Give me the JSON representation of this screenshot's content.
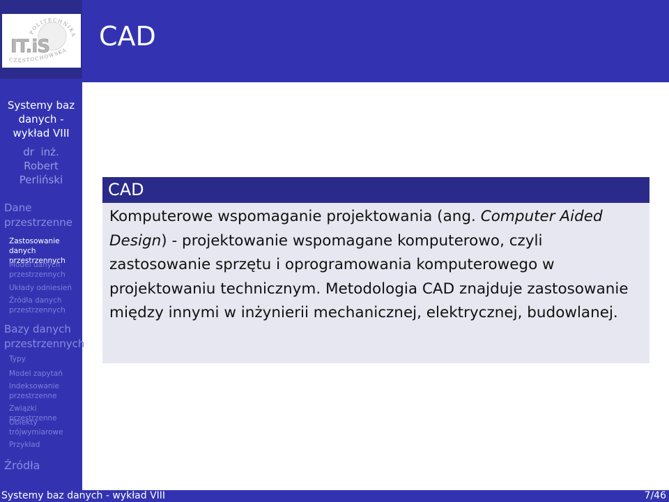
{
  "logo": {
    "name": "Politechnika Częstochowska ITiS logo",
    "main_text": "IT.iS",
    "arc_top_text": "POLITECHNIKA",
    "arc_bottom_text": "CZĘSTOCHOWSKA"
  },
  "header": {
    "frame_title": "CAD"
  },
  "sidebar": {
    "title_lines": [
      "Systemy baz",
      "danych -",
      "wykład VIII"
    ],
    "author_lines": [
      "dr  inż.",
      "Robert",
      "Perliński"
    ],
    "sections": [
      {
        "label_lines": [
          "Dane",
          "przestrzenne"
        ],
        "active": false,
        "items": [
          {
            "label_lines": [
              "Zastosowanie danych",
              "przestrzennych"
            ],
            "active": true
          },
          {
            "label_lines": [
              "Model danych",
              "przestrzennych"
            ],
            "active": false
          },
          {
            "label_lines": [
              "Układy odniesień"
            ],
            "active": false
          },
          {
            "label_lines": [
              "Źródła danych",
              "przestrzennych"
            ],
            "active": false
          }
        ]
      },
      {
        "label_lines": [
          "Bazy danych",
          "przestrzennych"
        ],
        "active": false,
        "items": [
          {
            "label_lines": [
              "Typy"
            ],
            "active": false
          },
          {
            "label_lines": [
              "Model zapytań"
            ],
            "active": false
          },
          {
            "label_lines": [
              "Indeksowanie",
              "przestrzenne"
            ],
            "active": false
          },
          {
            "label_lines": [
              "Związki przestrzenne"
            ],
            "active": false
          },
          {
            "label_lines": [
              "Obiekty",
              "trójwymiarowe"
            ],
            "active": false
          },
          {
            "label_lines": [
              "Przykład"
            ],
            "active": false
          }
        ]
      },
      {
        "label_lines": [
          "Źródła"
        ],
        "active": false,
        "items": []
      }
    ]
  },
  "block": {
    "title": "CAD",
    "body_parts": [
      {
        "text": "Komputerowe wspomaganie projektowania (ang. ",
        "italic": false
      },
      {
        "text": "Computer Aided Design",
        "italic": true
      },
      {
        "text": ") - projektowanie wspomagane komputerowo, czyli zastosowanie sprzętu i oprogramowania komputerowego w projektowaniu technicznym. Metodologia CAD znajduje zastosowanie między innymi w inżynierii mechanicznej, elektrycznej, budowlanej.",
        "italic": false
      }
    ]
  },
  "footer": {
    "left": "Systemy baz danych - wykład VIII",
    "page_current": "7",
    "page_total": "46",
    "page_label": "7/46"
  },
  "colors": {
    "sidebar_bg": "#3333b2",
    "logo_area_bg": "#2b2b8c",
    "block_title_bg": "#2a2a8a",
    "block_body_bg": "#e7e7f1",
    "inactive_nav": "#8a8ae0",
    "active_nav": "#ffffff"
  }
}
